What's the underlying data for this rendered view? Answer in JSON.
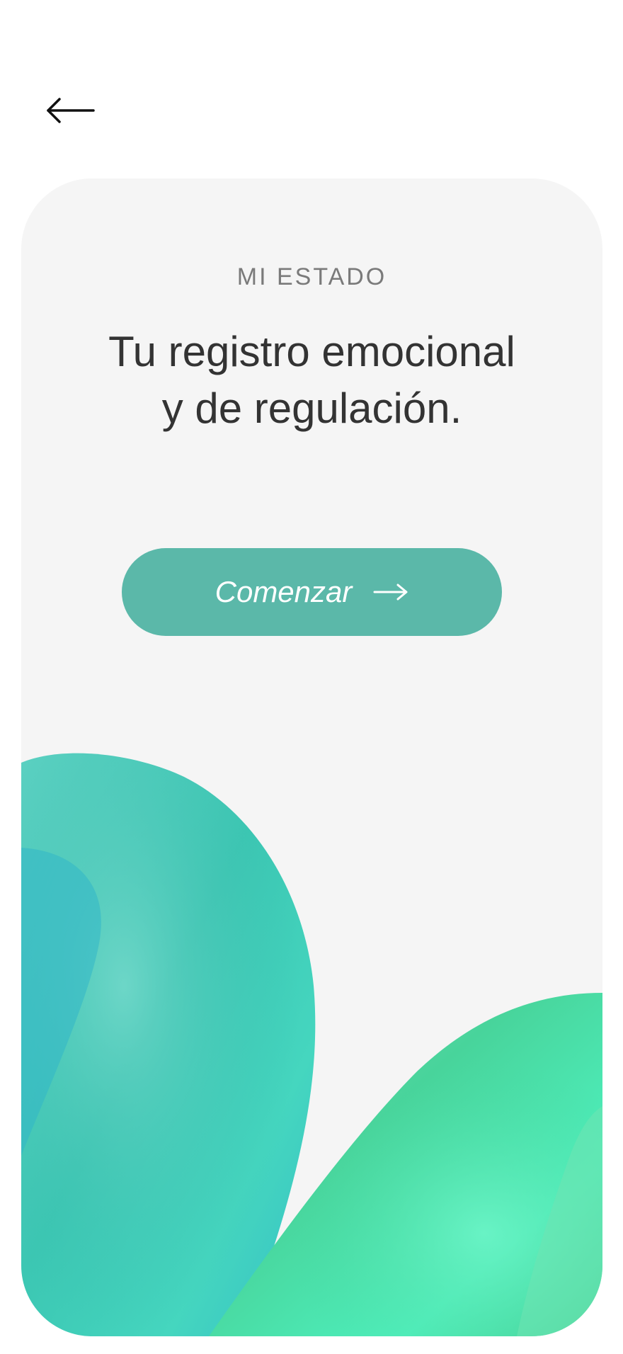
{
  "navigation": {
    "back_icon": "arrow-left-icon"
  },
  "intro": {
    "eyebrow": "MI ESTADO",
    "headline_line1": "Tu registro emocional",
    "headline_line2": "y de regulación.",
    "start_label": "Comenzar",
    "start_icon": "arrow-right-icon"
  },
  "colors": {
    "accent": "#5bb8a9",
    "card_background": "#f5f5f5",
    "text_primary": "#333333",
    "text_secondary": "#7a7a7a",
    "blob_teal": "#3fcfb8",
    "blob_green": "#52e3a6"
  }
}
